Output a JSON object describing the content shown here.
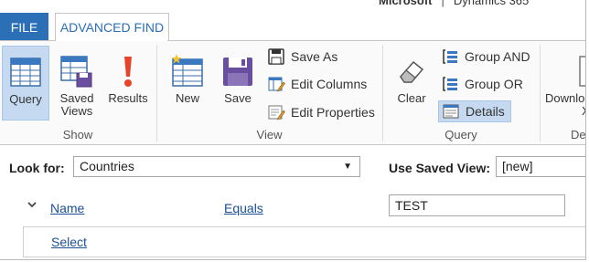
{
  "brand": {
    "vendor": "Microsoft",
    "separator": "|",
    "product": "Dynamics 365"
  },
  "tabs": [
    {
      "label": "FILE"
    },
    {
      "label": "ADVANCED FIND"
    }
  ],
  "ribbon": {
    "groups": {
      "show": {
        "label": "Show",
        "buttons": [
          {
            "label": "Query",
            "active": true
          },
          {
            "label_line1": "Saved",
            "label_line2": "Views"
          },
          {
            "label": "Results"
          }
        ]
      },
      "view": {
        "label": "View",
        "big_buttons": [
          {
            "label": "New"
          },
          {
            "label": "Save"
          }
        ],
        "small_buttons": [
          {
            "label": "Save As"
          },
          {
            "label": "Edit Columns"
          },
          {
            "label": "Edit Properties"
          }
        ]
      },
      "query": {
        "label": "Query",
        "big_buttons": [
          {
            "label": "Clear"
          }
        ],
        "small_buttons": [
          {
            "label": "Group AND"
          },
          {
            "label": "Group OR"
          },
          {
            "label": "Details",
            "active": true
          }
        ]
      },
      "download": {
        "label_partial": "De",
        "button_line1": "Downlo",
        "button_line2": "X"
      }
    }
  },
  "query_area": {
    "look_for_label": "Look for:",
    "look_for_value": "Countries",
    "saved_view_label": "Use Saved View:",
    "saved_view_value": "[new]",
    "condition": {
      "field": "Name",
      "operator": "Equals",
      "value": "TEST"
    },
    "select_link": "Select"
  },
  "colors": {
    "accent": "#2b6fb6",
    "active_bg": "#c5daf0",
    "link": "#1a4f96"
  }
}
